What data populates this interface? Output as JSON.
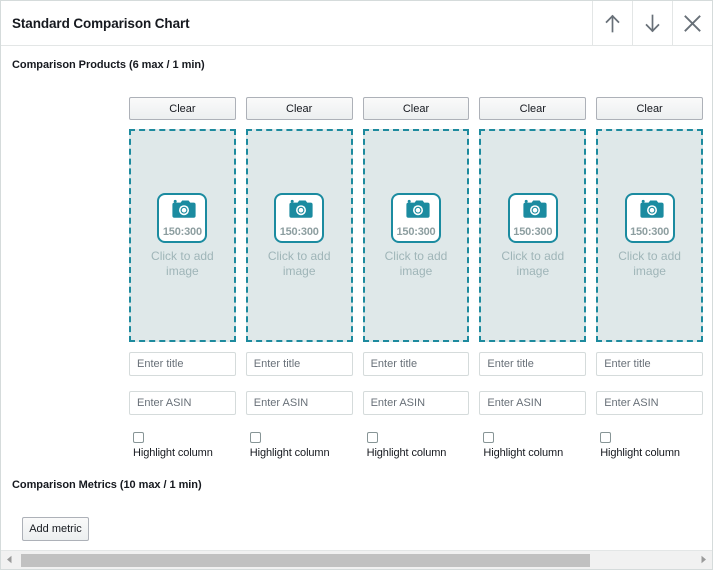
{
  "window": {
    "title": "Standard Comparison Chart",
    "actions": [
      {
        "name": "move-up-button",
        "icon": "arrow-up-icon",
        "label": "Move up"
      },
      {
        "name": "move-down-button",
        "icon": "arrow-down-icon",
        "label": "Move down"
      },
      {
        "name": "close-button",
        "icon": "close-icon",
        "label": "Close"
      }
    ]
  },
  "sections": {
    "products": {
      "label": "Comparison Products (6 max / 1 min)",
      "max": 6,
      "min": 1
    },
    "metrics": {
      "label": "Comparison Metrics (10 max / 1 min)",
      "max": 10,
      "min": 1,
      "add_button_label": "Add metric"
    }
  },
  "columns": [
    {
      "clear_label": "Clear",
      "dropzone": {
        "ratio": "150:300",
        "hint": "Click to add image",
        "icon": "camera-icon"
      },
      "title": {
        "value": "",
        "placeholder": "Enter title"
      },
      "asin": {
        "value": "",
        "placeholder": "Enter ASIN"
      },
      "highlight": {
        "label": "Highlight column",
        "checked": false
      }
    },
    {
      "clear_label": "Clear",
      "dropzone": {
        "ratio": "150:300",
        "hint": "Click to add image",
        "icon": "camera-icon"
      },
      "title": {
        "value": "",
        "placeholder": "Enter title"
      },
      "asin": {
        "value": "",
        "placeholder": "Enter ASIN"
      },
      "highlight": {
        "label": "Highlight column",
        "checked": false
      }
    },
    {
      "clear_label": "Clear",
      "dropzone": {
        "ratio": "150:300",
        "hint": "Click to add image",
        "icon": "camera-icon"
      },
      "title": {
        "value": "",
        "placeholder": "Enter title"
      },
      "asin": {
        "value": "",
        "placeholder": "Enter ASIN"
      },
      "highlight": {
        "label": "Highlight column",
        "checked": false
      }
    },
    {
      "clear_label": "Clear",
      "dropzone": {
        "ratio": "150:300",
        "hint": "Click to add image",
        "icon": "camera-icon"
      },
      "title": {
        "value": "",
        "placeholder": "Enter title"
      },
      "asin": {
        "value": "",
        "placeholder": "Enter ASIN"
      },
      "highlight": {
        "label": "Highlight column",
        "checked": false
      }
    },
    {
      "clear_label": "Clear",
      "dropzone": {
        "ratio": "150:300",
        "hint": "Click to add image",
        "icon": "camera-icon"
      },
      "title": {
        "value": "",
        "placeholder": "Enter title"
      },
      "asin": {
        "value": "",
        "placeholder": "Enter ASIN"
      },
      "highlight": {
        "label": "Highlight column",
        "checked": false
      }
    }
  ],
  "scrollbar": {
    "left_arrow_icon": "triangle-left-icon",
    "right_arrow_icon": "triangle-right-icon",
    "thumb_width_percent": 84
  },
  "colors": {
    "accent_teal": "#1d8a9e",
    "dropzone_fill": "#dfe8e9",
    "dropzone_hint": "#9fb5b8",
    "ratio_text": "#8d9ea0",
    "border": "#d5dbdb",
    "text": "#16191f",
    "icon_gray": "#687078"
  }
}
